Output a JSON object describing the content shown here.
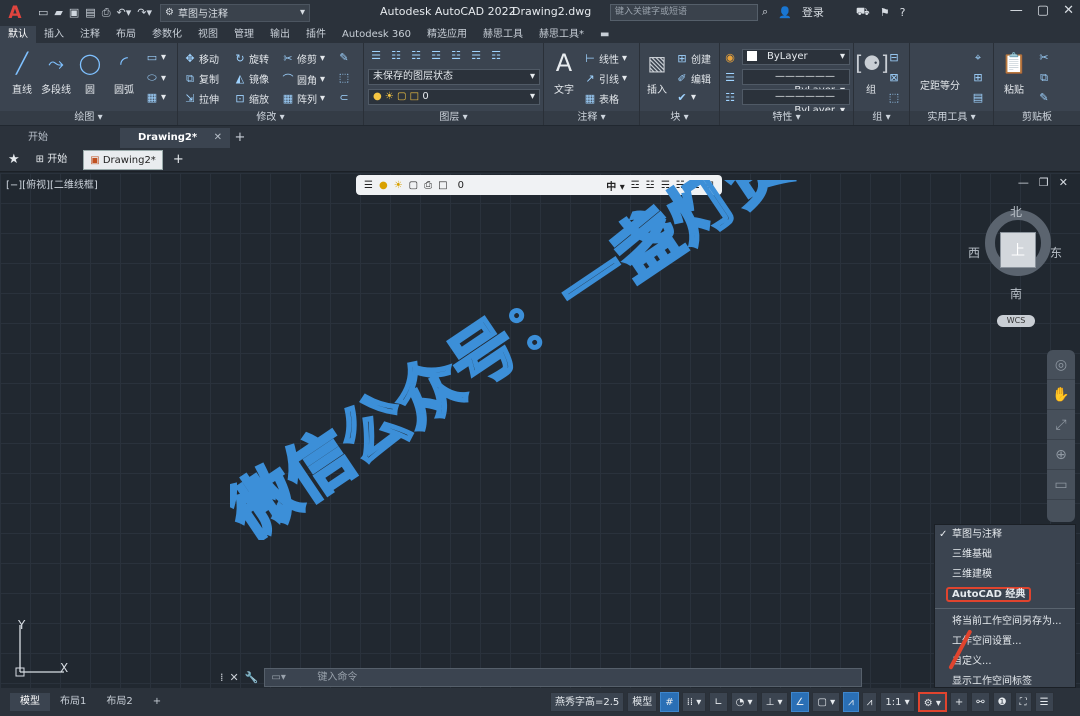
{
  "titlebar": {
    "logo": "A",
    "workspace": "草图与注释",
    "app_title": "Autodesk AutoCAD 2022",
    "doc_name": "Drawing2.dwg",
    "search_placeholder": "键入关键字或短语",
    "login": "登录"
  },
  "ribbon_tabs": [
    "默认",
    "插入",
    "注释",
    "布局",
    "参数化",
    "视图",
    "管理",
    "输出",
    "插件",
    "Autodesk 360",
    "精选应用",
    "赫思工具",
    "赫思工具*"
  ],
  "panels": {
    "draw": {
      "title": "绘图",
      "line": "直线",
      "polyline": "多段线",
      "circle": "圆",
      "arc": "圆弧"
    },
    "modify": {
      "title": "修改",
      "move": "移动",
      "rotate": "旋转",
      "trim": "修剪",
      "copy": "复制",
      "mirror": "镜像",
      "fillet": "圆角",
      "stretch": "拉伸",
      "scale": "缩放",
      "array": "阵列"
    },
    "layers": {
      "title": "图层",
      "state": "未保存的图层状态",
      "layer": "0"
    },
    "annotation": {
      "title": "注释",
      "text": "文字",
      "linear": "线性",
      "leader": "引线",
      "table": "表格"
    },
    "block": {
      "title": "块",
      "insert": "插入",
      "create": "创建",
      "edit": "编辑"
    },
    "properties": {
      "title": "特性",
      "bylayer1": "ByLayer",
      "bylayer2": "ByLayer",
      "bylayer3": "ByLayer"
    },
    "groups": {
      "title": "组",
      "group": "组"
    },
    "utilities": {
      "title": "实用工具",
      "measure": "定距等分"
    },
    "clipboard": {
      "title": "剪贴板",
      "paste": "粘贴"
    }
  },
  "file_tabs": {
    "start": "开始",
    "drawing": "Drawing2*"
  },
  "start_bar": {
    "start": "开始",
    "drawing": "Drawing2*"
  },
  "view_label": "[−][俯视][二维线框]",
  "layer_toolbar": {
    "layer": "0",
    "mid": "中"
  },
  "viewcube": {
    "north": "北",
    "south": "南",
    "east": "东",
    "west": "西",
    "top": "上",
    "wcs": "WCS"
  },
  "ucs": {
    "x": "X",
    "y": "Y"
  },
  "watermark": "微信公众号：一盏灯资源库",
  "command": {
    "placeholder": "键入命令"
  },
  "layout_tabs": [
    "模型",
    "布局1",
    "布局2"
  ],
  "status": {
    "text_height": "燕秀字高=2.5",
    "model": "模型",
    "scale": "1:1"
  },
  "workspace_menu": {
    "items": [
      "草图与注释",
      "三维基础",
      "三维建模",
      "AutoCAD 经典"
    ],
    "items2": [
      "将当前工作空间另存为...",
      "工作空间设置...",
      "自定义...",
      "显示工作空间标签"
    ]
  }
}
